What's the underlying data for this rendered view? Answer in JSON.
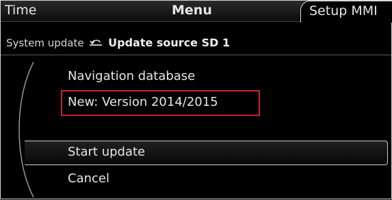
{
  "header": {
    "tab_time": "Time",
    "tab_menu": "Menu",
    "tab_setup": "Setup MMI"
  },
  "breadcrumb": {
    "parent": "System update",
    "back_icon": "back-arrow-icon",
    "title": "Update source SD 1"
  },
  "info": {
    "line1": "Navigation database",
    "line2": "New: Version 2014/2015"
  },
  "menu": {
    "start_update": "Start update",
    "cancel": "Cancel"
  },
  "colors": {
    "highlight_box": "#c4262e",
    "background": "#000000",
    "text": "#e6e6e6"
  }
}
